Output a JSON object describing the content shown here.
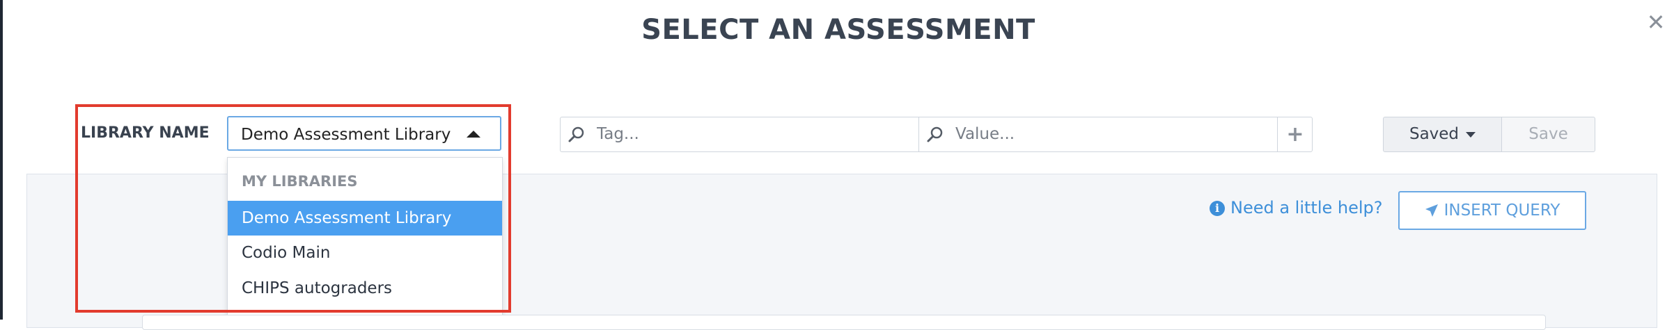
{
  "dialog": {
    "title": "SELECT AN ASSESSMENT",
    "close_icon": "close-icon"
  },
  "library": {
    "label": "LIBRARY NAME",
    "selected": "Demo Assessment Library",
    "dropdown": {
      "header": "MY LIBRARIES",
      "options": [
        "Demo Assessment Library",
        "Codio Main",
        "CHIPS autograders"
      ],
      "active_index": 0
    }
  },
  "query": {
    "tag_placeholder": "Tag...",
    "value_placeholder": "Value...",
    "add_icon": "plus-icon",
    "search_icon": "search-icon"
  },
  "saved": {
    "saved_label": "Saved",
    "save_label": "Save"
  },
  "help": {
    "label": "Need a little help?",
    "icon": "info-icon"
  },
  "insert": {
    "label": "INSERT QUERY",
    "icon": "paper-plane-icon"
  },
  "colors": {
    "accent": "#4a9ff0",
    "link": "#3d8fd9",
    "highlight_border": "#e23b2e"
  }
}
